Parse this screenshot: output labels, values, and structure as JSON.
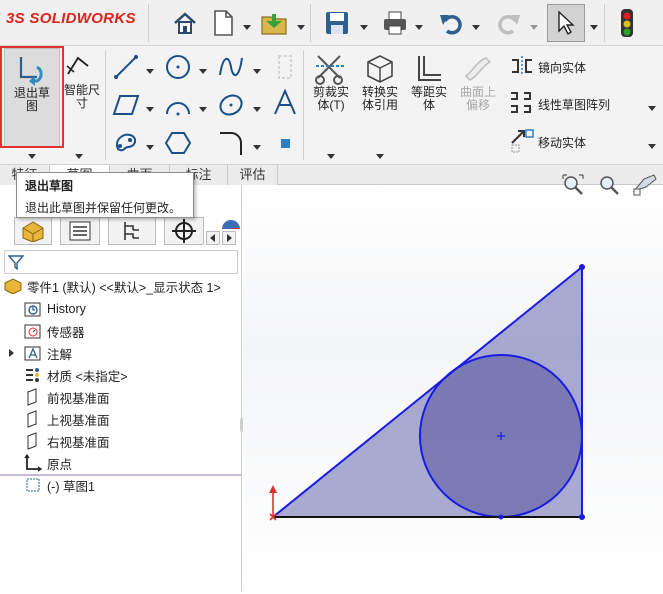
{
  "app": {
    "logo": "SOLIDWORKS",
    "logo_prefix": "3S"
  },
  "ribbon": {
    "exit_sketch_line1": "退出草",
    "exit_sketch_line2": "图",
    "smart_dim_line1": "智能尺",
    "smart_dim_line2": "寸",
    "trim_line1": "剪裁实",
    "trim_line2": "体(T)",
    "convert_line1": "转换实",
    "convert_line2": "体引用",
    "offset_line1": "等距实",
    "offset_line2": "体",
    "surface_offset_line1": "曲面上",
    "surface_offset_line2": "偏移",
    "mirror": "镜向实体",
    "linear_pattern": "线性草图阵列",
    "move": "移动实体"
  },
  "tabs": [
    "特征",
    "草图",
    "曲面",
    "标注",
    "评估"
  ],
  "tooltip": {
    "title": "退出草图",
    "description": "退出此草图并保留任何更改。"
  },
  "tree": {
    "root": "零件1 (默认) <<默认>_显示状态 1>",
    "items": [
      {
        "label": "History"
      },
      {
        "label": "传感器"
      },
      {
        "label": "注解"
      },
      {
        "label": "材质 <未指定>"
      },
      {
        "label": "前视基准面"
      },
      {
        "label": "上视基准面"
      },
      {
        "label": "右视基准面"
      },
      {
        "label": "原点"
      },
      {
        "label": "(-) 草图1"
      }
    ]
  },
  "colors": {
    "accent_red": "#d9241b",
    "sketch_blue": "#1a1ae6",
    "fill": "#8c8fc0",
    "highlight": "#e03030"
  }
}
